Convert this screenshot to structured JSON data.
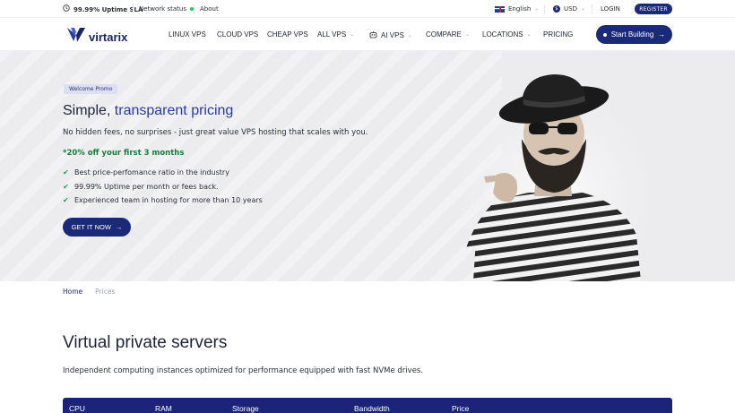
{
  "topbar": {
    "uptime": "99.99% Uptime SLA",
    "network_status": "Network status",
    "about": "About",
    "language": "English",
    "currency": "USD",
    "login": "LOGIN",
    "register": "REGISTER"
  },
  "nav": {
    "brand": "virtarix",
    "items": [
      "LINUX VPS",
      "CLOUD VPS",
      "CHEAP VPS",
      "ALL VPS",
      "AI VPS",
      "COMPARE",
      "LOCATIONS",
      "PRICING"
    ],
    "cta": "Start Building"
  },
  "hero": {
    "badge": "Welcome Promo",
    "title_main": "Simple,",
    "title_accent": " transparent pricing",
    "subtitle": "No hidden fees, no surprises - just great value VPS hosting that scales with you.",
    "promo": "*20% off your first 3 months",
    "features": [
      "Best price-perfomance ratio in the industry",
      "99.99% Uptime per month or fees back.",
      "Experienced team in hosting for more than 10 years"
    ],
    "cta": "GET IT NOW"
  },
  "breadcrumb": {
    "home": "Home",
    "current": "Prices"
  },
  "section": {
    "title": "Virtual private servers",
    "subtitle": "Independent computing instances optimized for performance equipped with fast NVMe drives."
  },
  "table": {
    "headers": [
      "CPU",
      "RAM",
      "Storage",
      "Bandwidth",
      "Price"
    ]
  },
  "colors": {
    "primary": "#1b2a78",
    "accent": "#2a3aa0",
    "promo": "#15803d",
    "check": "#16a34a"
  }
}
